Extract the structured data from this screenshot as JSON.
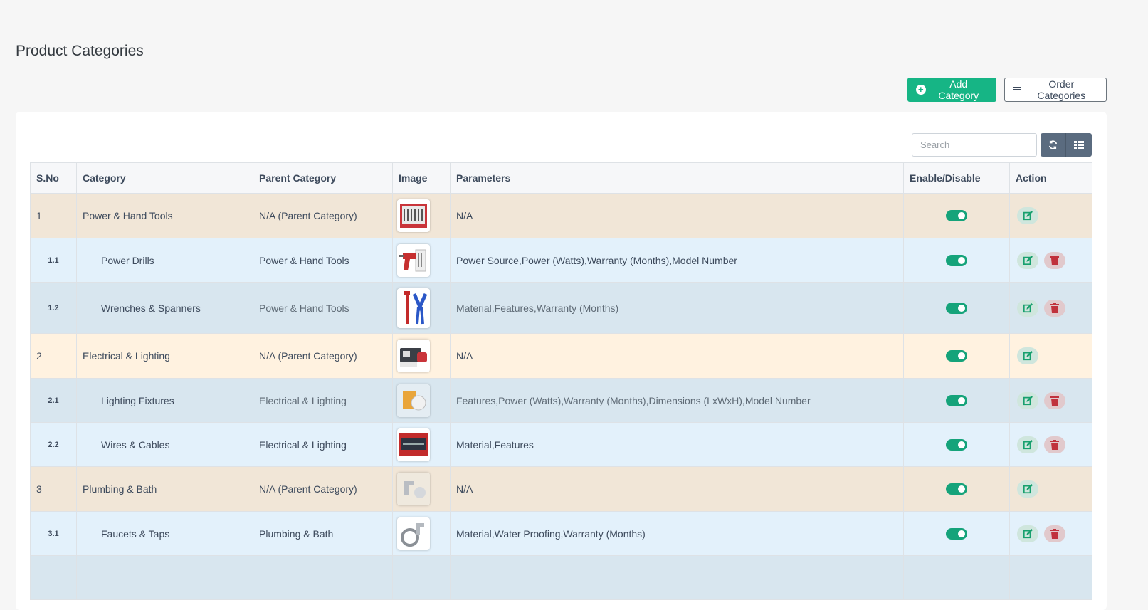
{
  "page": {
    "title": "Product Categories"
  },
  "buttons": {
    "add_category": "Add Category",
    "order_categories": "Order Categories"
  },
  "search": {
    "placeholder": "Search"
  },
  "table": {
    "headers": [
      "S.No",
      "Category",
      "Parent Category",
      "Image",
      "Parameters",
      "Enable/Disable",
      "Action"
    ],
    "rows": [
      {
        "sno": "1",
        "category": "Power & Hand Tools",
        "parent": "N/A (Parent Category)",
        "parameters": "N/A",
        "enabled": true
      },
      {
        "sno": "1.1",
        "category": "Power Drills",
        "parent": "Power & Hand Tools",
        "parameters": "Power Source,Power (Watts),Warranty (Months),Model Number",
        "enabled": true
      },
      {
        "sno": "1.2",
        "category": "Wrenches & Spanners",
        "parent": "Power & Hand Tools",
        "parameters": "Material,Features,Warranty (Months)",
        "enabled": true
      },
      {
        "sno": "2",
        "category": "Electrical & Lighting",
        "parent": "N/A (Parent Category)",
        "parameters": "N/A",
        "enabled": true
      },
      {
        "sno": "2.1",
        "category": "Lighting Fixtures",
        "parent": "Electrical & Lighting",
        "parameters": "Features,Power (Watts),Warranty (Months),Dimensions (LxWxH),Model Number",
        "enabled": true
      },
      {
        "sno": "2.2",
        "category": "Wires & Cables",
        "parent": "Electrical & Lighting",
        "parameters": "Material,Features",
        "enabled": true
      },
      {
        "sno": "3",
        "category": "Plumbing & Bath",
        "parent": "N/A (Parent Category)",
        "parameters": "N/A",
        "enabled": true
      },
      {
        "sno": "3.1",
        "category": "Faucets & Taps",
        "parent": "Plumbing & Bath",
        "parameters": "Material,Water Proofing,Warranty (Months)",
        "enabled": true
      }
    ]
  },
  "colors": {
    "accent": "#16b585",
    "toggle_on": "#15a37a",
    "row_parent_tan": "#f1e6d7",
    "row_parent_cream": "#fff2e0",
    "row_child_light": "#e3f1fb",
    "row_child_dark": "#d8e6ef",
    "edit_button": "#cfe6dd",
    "delete_button": "#e1c9cc"
  },
  "icons": {
    "add": "plus-circle-icon",
    "order": "list-lines-icon",
    "refresh": "refresh-icon",
    "columns": "list-view-icon",
    "edit": "edit-icon",
    "delete": "trash-icon"
  }
}
